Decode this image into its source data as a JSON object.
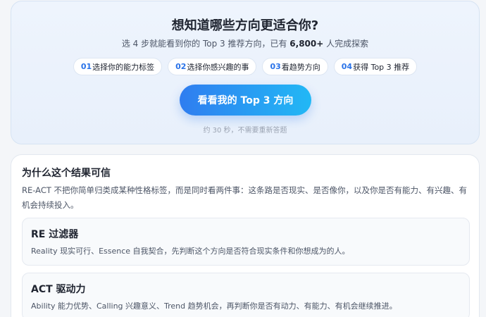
{
  "hero": {
    "title": "想知道哪些方向更适合你?",
    "subtitle_before": "选 4 步就能看到你的 Top 3 推荐方向，已有 ",
    "subtitle_count": "6,800+",
    "subtitle_after": " 人完成探索",
    "steps": [
      {
        "num": "01",
        "label": "选择你的能力标签"
      },
      {
        "num": "02",
        "label": "选择你感兴趣的事"
      },
      {
        "num": "03",
        "label": "看趋势方向"
      },
      {
        "num": "04",
        "label": "获得 Top 3 推荐"
      }
    ],
    "cta_label": "看看我的 Top 3 方向",
    "cta_note": "约 30 秒，不需要重新答题"
  },
  "trust": {
    "title": "为什么这个结果可信",
    "description": "RE-ACT 不把你简单归类成某种性格标签，而是同时看两件事：这条路是否现实、是否像你，以及你是否有能力、有兴趣、有机会持续投入。",
    "cards": [
      {
        "title": "RE 过滤器",
        "description": "Reality 现实可行、Essence 自我契合，先判断这个方向是否符合现实条件和你想成为的人。"
      },
      {
        "title": "ACT 驱动力",
        "description": "Ability 能力优势、Calling 兴趣意义、Trend 趋势机会，再判断你是否有动力、有能力、有机会继续推进。"
      }
    ]
  }
}
